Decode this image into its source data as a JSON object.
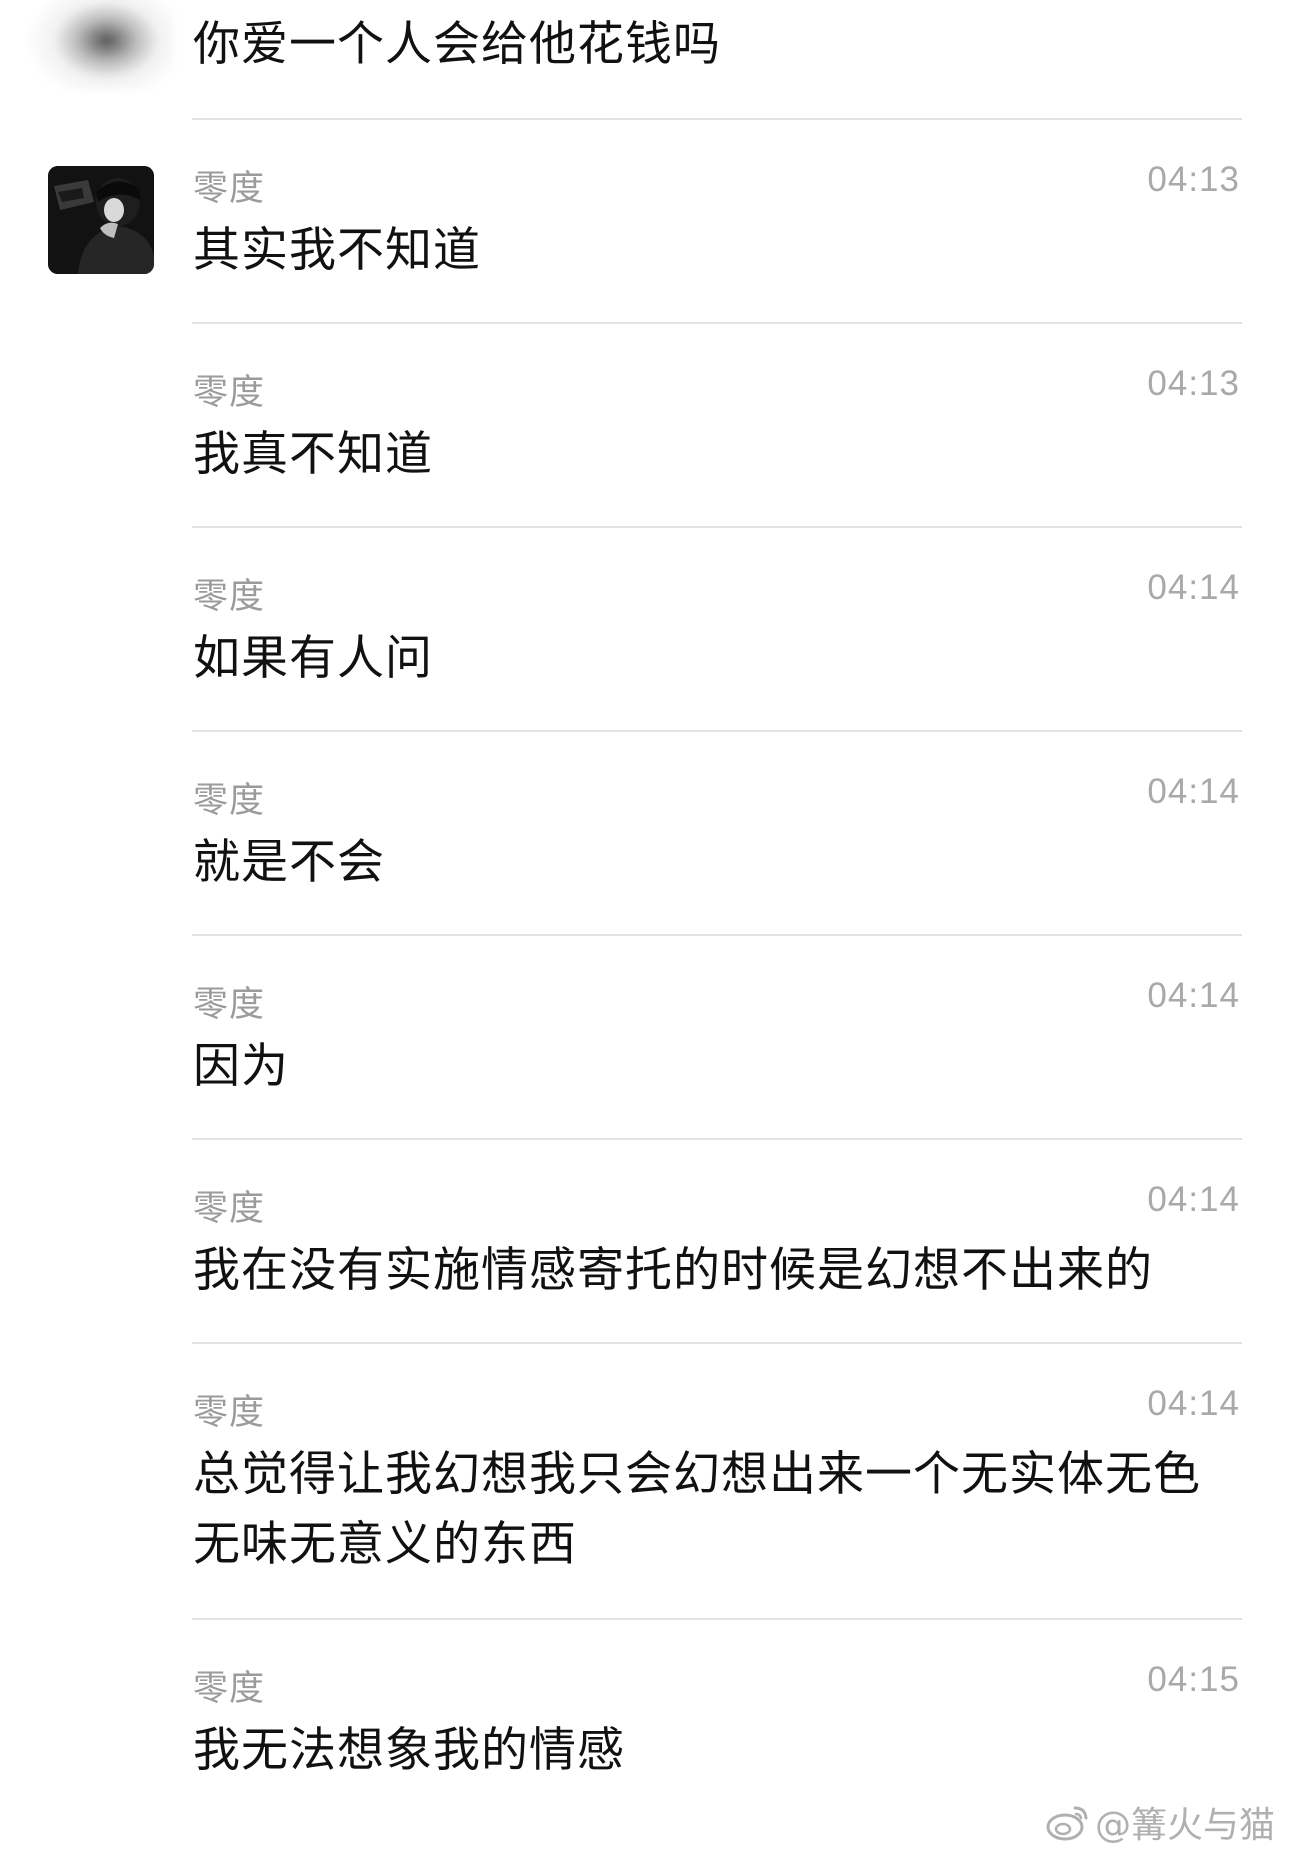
{
  "messages": [
    {
      "sender": "",
      "time": "",
      "text": "你爱一个人会给他花钱吗"
    },
    {
      "sender": "零度",
      "time": "04:13",
      "text": "其实我不知道"
    },
    {
      "sender": "零度",
      "time": "04:13",
      "text": "我真不知道"
    },
    {
      "sender": "零度",
      "time": "04:14",
      "text": "如果有人问"
    },
    {
      "sender": "零度",
      "time": "04:14",
      "text": "就是不会"
    },
    {
      "sender": "零度",
      "time": "04:14",
      "text": "因为"
    },
    {
      "sender": "零度",
      "time": "04:14",
      "text": "我在没有实施情感寄托的时候是幻想不出来的"
    },
    {
      "sender": "零度",
      "time": "04:14",
      "text": "总觉得让我幻想我只会幻想出来一个无实体无色无味无意义的东西"
    },
    {
      "sender": "零度",
      "time": "04:15",
      "text": "我无法想象我的情感"
    }
  ],
  "watermark": {
    "text": "@篝火与猫",
    "icon": "weibo-icon"
  }
}
